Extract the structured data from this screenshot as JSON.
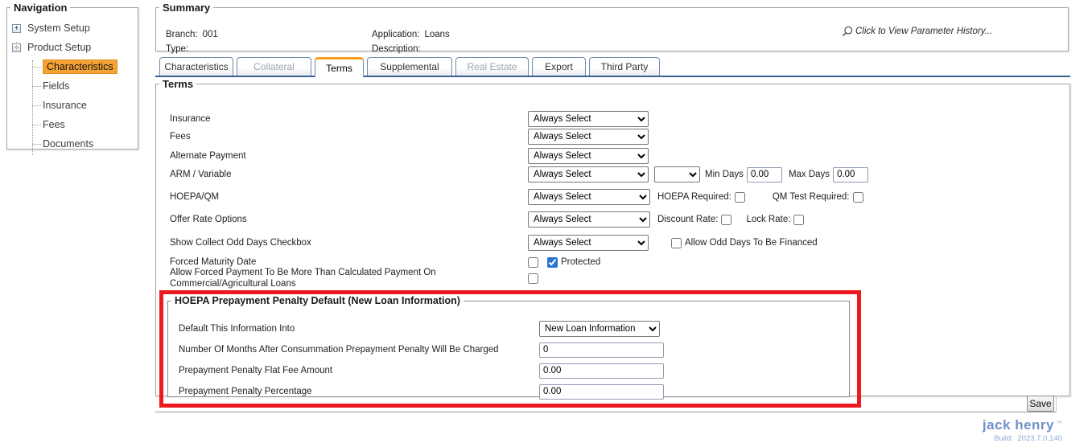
{
  "colors": {
    "nav_highlight_orange": "#F5A234",
    "tab_active_accent": "#F6A01E",
    "tabstrip_line_blue": "#3A5F94",
    "highlight_box_red": "#EA1A20",
    "checkbox_accent_blue": "#2874D4",
    "logo_blue": "#7090C8",
    "build_text_blue": "#8FA8D8"
  },
  "navigation": {
    "legend": "Navigation",
    "items": [
      {
        "label": "System Setup",
        "type": "root",
        "expander": "+"
      },
      {
        "label": "Product Setup",
        "type": "root",
        "expander": "−"
      },
      {
        "label": "Characteristics",
        "type": "child",
        "selected": true
      },
      {
        "label": "Fields",
        "type": "child",
        "selected": false
      },
      {
        "label": "Insurance",
        "type": "child",
        "selected": false
      },
      {
        "label": "Fees",
        "type": "child",
        "selected": false
      },
      {
        "label": "Documents",
        "type": "child",
        "selected": false
      }
    ]
  },
  "summary": {
    "legend": "Summary",
    "branch": {
      "label": "Branch:",
      "value": "001"
    },
    "type": {
      "label": "Type:",
      "value": ""
    },
    "application": {
      "label": "Application:",
      "value": "Loans"
    },
    "description": {
      "label": "Description:",
      "value": ""
    },
    "history_link": "Click to View Parameter History..."
  },
  "tabs": [
    {
      "label": "Characteristics",
      "state": "normal"
    },
    {
      "label": "Collateral",
      "state": "disabled"
    },
    {
      "label": "Terms",
      "state": "active"
    },
    {
      "label": "Supplemental",
      "state": "normal"
    },
    {
      "label": "Real Estate",
      "state": "disabled"
    },
    {
      "label": "Export",
      "state": "normal"
    },
    {
      "label": "Third Party",
      "state": "normal"
    }
  ],
  "terms": {
    "legend": "Terms",
    "insurance": {
      "label": "Insurance",
      "selected": "Always Select"
    },
    "fees": {
      "label": "Fees",
      "selected": "Always Select"
    },
    "alternate_payment": {
      "label": "Alternate Payment",
      "selected": "Always Select"
    },
    "arm_variable": {
      "label": "ARM / Variable",
      "selected": "Always Select",
      "secondary_selected": "",
      "min_days_label": "Min Days",
      "min_days_value": "0.00",
      "max_days_label": "Max Days",
      "max_days_value": "0.00"
    },
    "hoepa_qm": {
      "label": "HOEPA/QM",
      "selected": "Always Select",
      "hoepa_required_label": "HOEPA Required:",
      "hoepa_required_checked": false,
      "qm_test_label": "QM Test Required:",
      "qm_test_checked": false
    },
    "offer_rate_options": {
      "label": "Offer Rate Options",
      "selected": "Always Select",
      "discount_rate_label": "Discount Rate:",
      "discount_rate_checked": false,
      "lock_rate_label": "Lock Rate:",
      "lock_rate_checked": false
    },
    "show_collect_odd_days": {
      "label": "Show Collect Odd Days Checkbox",
      "selected": "Always Select",
      "financed_label": "Allow Odd Days To Be Financed",
      "financed_checked": false
    },
    "forced_maturity_date": {
      "label": "Forced Maturity Date",
      "checked": false,
      "protected_label": "Protected",
      "protected_checked": true
    },
    "allow_forced_payment": {
      "label": "Allow Forced Payment To Be More Than Calculated Payment On Commercial/Agricultural Loans",
      "checked": false
    }
  },
  "hoepa_prepayment": {
    "legend": "HOEPA Prepayment Penalty Default (New Loan Information)",
    "default_into": {
      "label": "Default This Information Into",
      "selected": "New Loan Information"
    },
    "months": {
      "label": "Number Of Months After Consummation Prepayment Penalty Will Be Charged",
      "value": "0"
    },
    "flat_fee": {
      "label": "Prepayment Penalty Flat Fee Amount",
      "value": "0.00"
    },
    "percentage": {
      "label": "Prepayment Penalty Percentage",
      "value": "0.00"
    }
  },
  "footer": {
    "save_label": "Save"
  },
  "branding": {
    "logo_text": "jack henry",
    "trademark": "™",
    "build_label": "Build:",
    "build_value": "2023.7.0.140"
  }
}
